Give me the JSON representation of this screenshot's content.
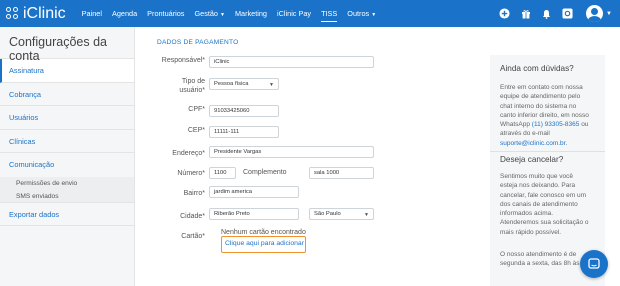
{
  "brand": {
    "name": "iClinic"
  },
  "nav": [
    {
      "label": "Painel",
      "caret": false
    },
    {
      "label": "Agenda",
      "caret": false
    },
    {
      "label": "Prontuários",
      "caret": false
    },
    {
      "label": "Gestão",
      "caret": true
    },
    {
      "label": "Marketing",
      "caret": false
    },
    {
      "label": "iClinic Pay",
      "caret": false
    },
    {
      "label": "TISS",
      "caret": false
    },
    {
      "label": "Outros",
      "caret": true
    }
  ],
  "top_icons": [
    "add-icon",
    "gift-icon",
    "bell-icon",
    "gear-icon",
    "user-avatar"
  ],
  "sidebar": {
    "title": "Configurações da conta",
    "items": [
      {
        "label": "Assinatura",
        "active": true
      },
      {
        "label": "Cobrança"
      },
      {
        "label": "Usuários"
      },
      {
        "label": "Clínicas"
      },
      {
        "label": "Comunicação"
      }
    ],
    "subitems": [
      "Permissões de envio",
      "SMS enviados"
    ],
    "last": "Exportar dados"
  },
  "form": {
    "section_title": "DADOS DE PAGAMENTO",
    "labels": {
      "responsavel": "Responsável*",
      "tipo_1": "Tipo de",
      "tipo_2": "usuário*",
      "cpf": "CPF*",
      "cep": "CEP*",
      "endereco": "Endereço*",
      "numero": "Número*",
      "complemento": "Complemento",
      "bairro": "Bairro*",
      "cidade": "Cidade*",
      "cartao": "Cartão*"
    },
    "values": {
      "responsavel": "iClinic",
      "tipo": "Pessoa física",
      "cpf": "91033425060",
      "cep": "11111-111",
      "endereco": "Presidente Vargas",
      "numero": "1100",
      "complemento": "sala 1000",
      "bairro": "jardim america",
      "cidade": "Riberão Preto",
      "estado": "São Paulo"
    },
    "no_card": "Nenhum cartão encontrado",
    "add_card": "Clique aqui para adicionar"
  },
  "help": {
    "title1": "Ainda com dúvidas?",
    "para1_lines": [
      "Entre em contato com nossa",
      "equipe de atendimento pelo",
      "chat interno do sistema no",
      "canto inferior direito, em nosso"
    ],
    "para1_wa_prefix": "WhatsApp ",
    "para1_phone": "(11) 93305-8365",
    "para1_suffix": " ou",
    "para1_mail_intro": "através do e-mail",
    "para1_email": "suporte@iclinic.com.br",
    "para1_end": ".",
    "title2": "Deseja cancelar?",
    "para2_lines": [
      "Sentimos muito que você",
      "esteja nos deixando. Para",
      "cancelar, fale conosco em um",
      "dos canais de atendimento",
      "informados acima.",
      "Atenderemos sua solicitação o",
      "mais rápido possível."
    ],
    "para3_lines": [
      "O nosso atendimento é de",
      "segunda a sexta, das 8h às"
    ]
  },
  "colors": {
    "primary": "#1a73c8",
    "highlight": "#f0922a"
  }
}
